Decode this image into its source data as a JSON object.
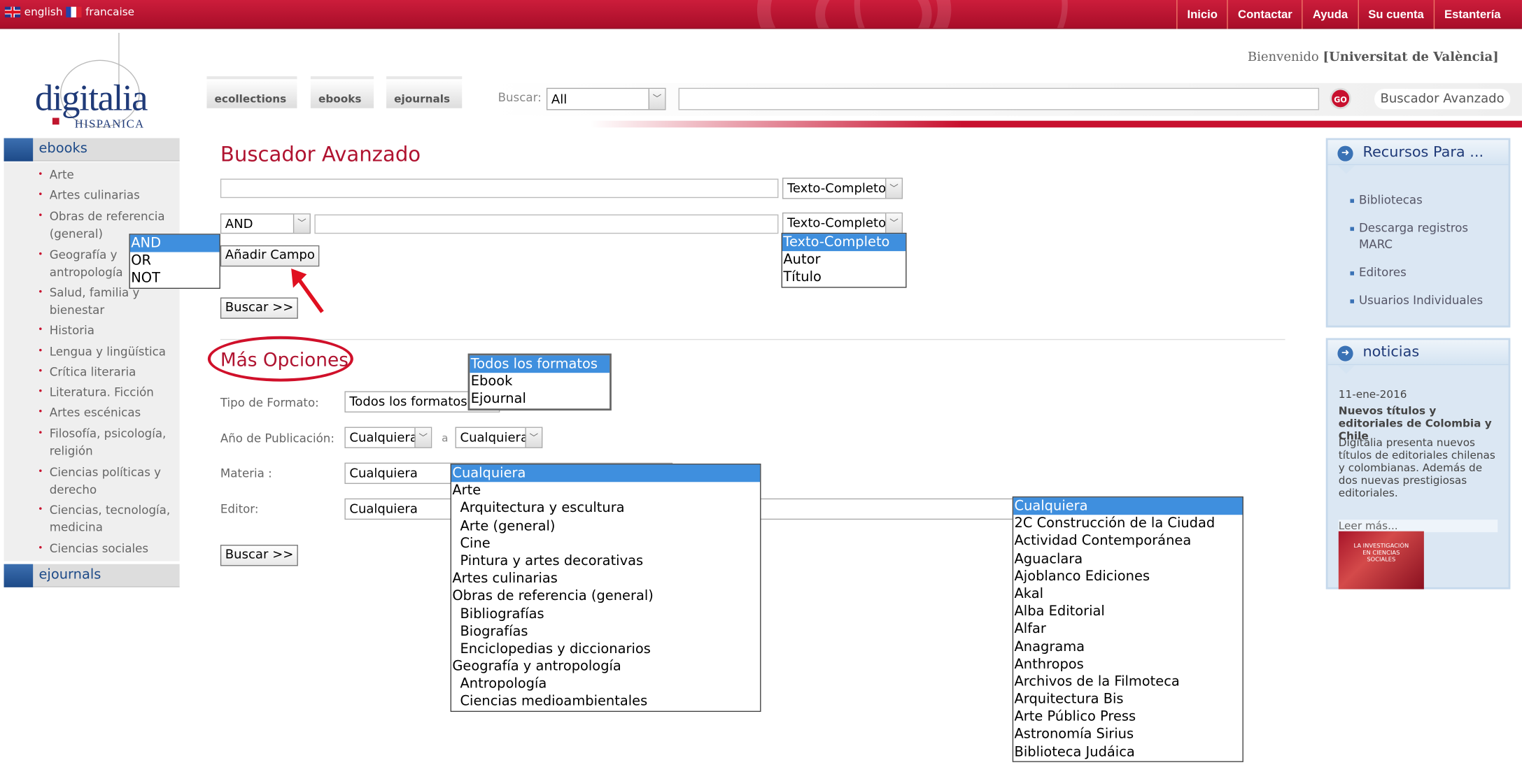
{
  "header": {
    "lang_en": "english",
    "lang_fr": "francaise",
    "nav": [
      "Inicio",
      "Contactar",
      "Ayuda",
      "Su cuenta",
      "Estantería"
    ],
    "welcome_prefix": "Bienvenido",
    "welcome_user": "[Universitat de València]",
    "logo_word": "digitalia",
    "logo_sub": "HISPANICA"
  },
  "tabs": [
    "ecollections",
    "ebooks",
    "ejournals"
  ],
  "search": {
    "label": "Buscar:",
    "scope": "All",
    "value": "",
    "go": "GO",
    "advanced_button": "Buscador Avanzado"
  },
  "sidebar": {
    "ebooks_title": "ebooks",
    "ebooks_items": [
      "Arte",
      "Artes culinarias",
      "Obras de referencia (general)",
      "Geografía y antropología",
      "Salud, familia y bienestar",
      "Historia",
      "Lengua y lingüística",
      "Crítica literaria",
      "Literatura. Ficción",
      "Artes escénicas",
      "Filosofía, psicología, religión",
      "Ciencias políticas y derecho",
      "Ciencias, tecnología, medicina",
      "Ciencias sociales"
    ],
    "ejournals_title": "ejournals"
  },
  "advanced": {
    "title": "Buscador Avanzado",
    "field_type_1": "Texto-Completo",
    "operator": "AND",
    "field_type_2": "Texto-Completo",
    "add_field": "Añadir Campo",
    "search_button": "Buscar >>",
    "operator_options": [
      "AND",
      "OR",
      "NOT"
    ],
    "field_type_options": [
      "Texto-Completo",
      "Autor",
      "Título"
    ]
  },
  "more_options": {
    "title": "Más Opciones",
    "format_label": "Tipo de Formato:",
    "format_value": "Todos los formatos",
    "format_options": [
      "Todos los formatos",
      "Ebook",
      "Ejournal"
    ],
    "year_label": "Año de Publicación:",
    "year_from": "Cualquiera",
    "year_sep": "a",
    "year_to": "Cualquiera",
    "subject_label": "Materia :",
    "subject_value": "Cualquiera",
    "subject_options": [
      "Cualquiera",
      "Arte",
      "Arquitectura y escultura",
      "Arte (general)",
      "Cine",
      "Pintura y artes decorativas",
      "Artes culinarias",
      "Obras de referencia (general)",
      "Bibliografías",
      "Biografías",
      "Enciclopedias y diccionarios",
      "Geografía y antropología",
      "Antropología",
      "Ciencias medioambientales"
    ],
    "publisher_label": "Editor:",
    "publisher_value": "Cualquiera",
    "publisher_options": [
      "Cualquiera",
      "2C Construcción de la Ciudad",
      "Actividad Contemporánea",
      "Aguaclara",
      "Ajoblanco Ediciones",
      "Akal",
      "Alba Editorial",
      "Alfar",
      "Anagrama",
      "Anthropos",
      "Archivos de la Filmoteca",
      "Arquitectura Bis",
      "Arte Público Press",
      "Astronomía Sirius",
      "Biblioteca Judáica"
    ],
    "search_button": "Buscar >>"
  },
  "right": {
    "recursos_title": "Recursos Para ...",
    "recursos_links": [
      "Bibliotecas",
      "Descarga registros MARC",
      "Editores",
      "Usuarios Individuales"
    ],
    "noticias_title": "noticias",
    "news_date": "11-ene-2016",
    "news_headline": "Nuevos títulos y editoriales de Colombia y Chile",
    "news_body": "Digitalia presenta nuevos títulos de editoriales chilenas y colombianas. Además de dos nuevas prestigiosas editoriales.",
    "read_more": "Leer más...",
    "thumb_text": "LA INVESTIGACIÓN EN CIENCIAS SOCIALES"
  },
  "colors": {
    "brand_red": "#c8102e",
    "brand_blue": "#1f3a78",
    "highlight": "#3f8fde"
  }
}
